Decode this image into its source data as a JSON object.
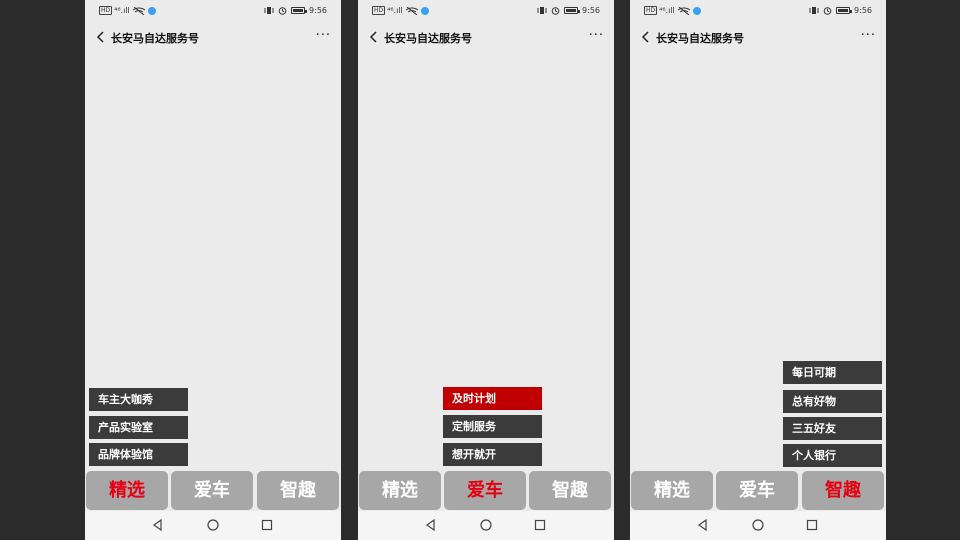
{
  "status": {
    "time": "9:56",
    "network": "HD",
    "signal": "⁴⁶.ıll"
  },
  "header": {
    "title": "长安马自达服务号",
    "more": "···"
  },
  "tabs": [
    "精选",
    "爱车",
    "智趣"
  ],
  "screens": [
    {
      "selected_tab": 0,
      "menu": [
        "车主大咖秀",
        "产品实验室",
        "品牌体验馆"
      ],
      "active_item": -1
    },
    {
      "selected_tab": 1,
      "menu": [
        "及时计划",
        "定制服务",
        "想开就开"
      ],
      "active_item": 0
    },
    {
      "selected_tab": 2,
      "menu": [
        "每日可期",
        "总有好物",
        "三五好友",
        "个人银行"
      ],
      "active_item": -1
    }
  ],
  "colors": {
    "active_menu": "#c00000",
    "selected_tab_text": "#e60012",
    "tab_bg": "#a7a7a7",
    "menu_bg": "#3b3b3b"
  }
}
